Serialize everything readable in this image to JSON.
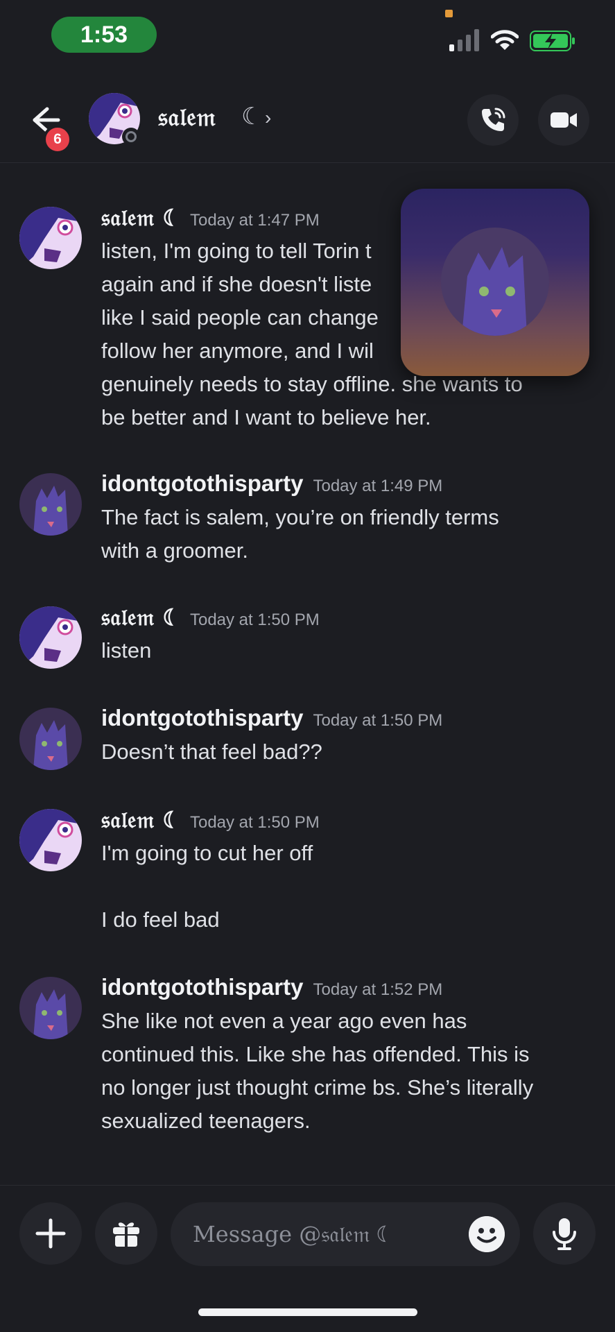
{
  "status": {
    "time": "1:53"
  },
  "header": {
    "back_badge": "6",
    "name": "𝔰𝔞𝔩𝔢𝔪",
    "moon": "☾",
    "chevron": "›"
  },
  "messages": [
    {
      "author": "𝔰𝔞𝔩𝔢𝔪 ☾",
      "time": "Today at 1:47 PM",
      "text": "listen, I'm going to tell Torin t\nagain and if she doesn't liste\nlike I said people can change\nfollow her anymore, and I wil\ngenuinely needs to stay offline. she wants to\nbe better and I want to believe her."
    },
    {
      "author": "idontgotothisparty",
      "time": "Today at 1:49 PM",
      "text": "The fact is salem, you’re on friendly terms\nwith a groomer."
    },
    {
      "author": "𝔰𝔞𝔩𝔢𝔪 ☾",
      "time": "Today at 1:50 PM",
      "text": "listen"
    },
    {
      "author": "idontgotothisparty",
      "time": "Today at 1:50 PM",
      "text": "Doesn’t that feel bad??"
    },
    {
      "author": "𝔰𝔞𝔩𝔢𝔪 ☾",
      "time": "Today at 1:50 PM",
      "text": "I'm going to cut her off\n\nI do feel bad"
    },
    {
      "author": "idontgotothisparty",
      "time": "Today at 1:52 PM",
      "text": "She like not even a year ago even has\ncontinued this. Like she has offended. This is\nno longer just thought crime bs. She’s literally\nsexualized teenagers."
    }
  ],
  "composer": {
    "placeholder": "Message @𝔰𝔞𝔩𝔢𝔪 ☾"
  },
  "icons": {
    "back": "arrow-left-icon",
    "call": "phone-icon",
    "video": "video-camera-icon",
    "add": "plus-icon",
    "gift": "gift-icon",
    "emoji": "emoji-icon",
    "mic": "microphone-icon"
  },
  "colors": {
    "background": "#1c1d22",
    "badge": "#e8414b",
    "time_pill": "#23863c",
    "surface": "#25262c"
  }
}
